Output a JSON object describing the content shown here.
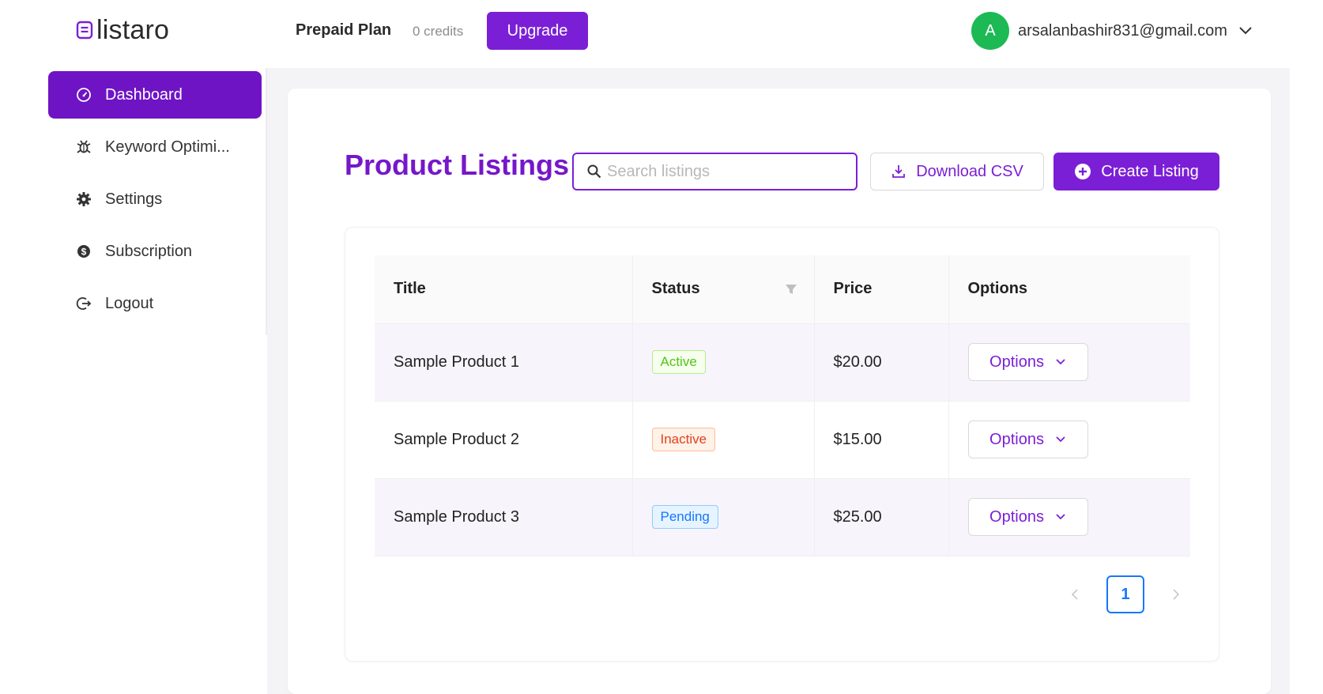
{
  "header": {
    "logo_text": "listaro",
    "plan_label": "Prepaid Plan",
    "credits": "0 credits",
    "upgrade_label": "Upgrade",
    "user": {
      "avatar_initial": "A",
      "email": "arsalanbashir831@gmail.com"
    }
  },
  "sidebar": {
    "items": [
      {
        "label": "Dashboard",
        "icon": "dashboard-icon",
        "active": true
      },
      {
        "label": "Keyword Optimi...",
        "icon": "bug-icon",
        "active": false
      },
      {
        "label": "Settings",
        "icon": "gear-icon",
        "active": false
      },
      {
        "label": "Subscription",
        "icon": "dollar-icon",
        "active": false
      },
      {
        "label": "Logout",
        "icon": "logout-icon",
        "active": false
      }
    ]
  },
  "main": {
    "title": "Product Listings",
    "search_placeholder": "Search listings",
    "search_value": "",
    "download_label": "Download CSV",
    "create_label": "Create Listing",
    "table": {
      "columns": [
        "Title",
        "Status",
        "Price",
        "Options"
      ],
      "rows": [
        {
          "title": "Sample Product 1",
          "status": "Active",
          "price": "$20.00",
          "options": "Options"
        },
        {
          "title": "Sample Product 2",
          "status": "Inactive",
          "price": "$15.00",
          "options": "Options"
        },
        {
          "title": "Sample Product 3",
          "status": "Pending",
          "price": "$25.00",
          "options": "Options"
        }
      ]
    },
    "pagination": {
      "current_page": "1"
    }
  },
  "colors": {
    "accent": "#7b1fd6",
    "sidebar_active": "#6e14c4",
    "avatar": "#1db954",
    "status_active": "#52c41a",
    "status_inactive": "#e2401d",
    "status_pending": "#1677ff"
  }
}
